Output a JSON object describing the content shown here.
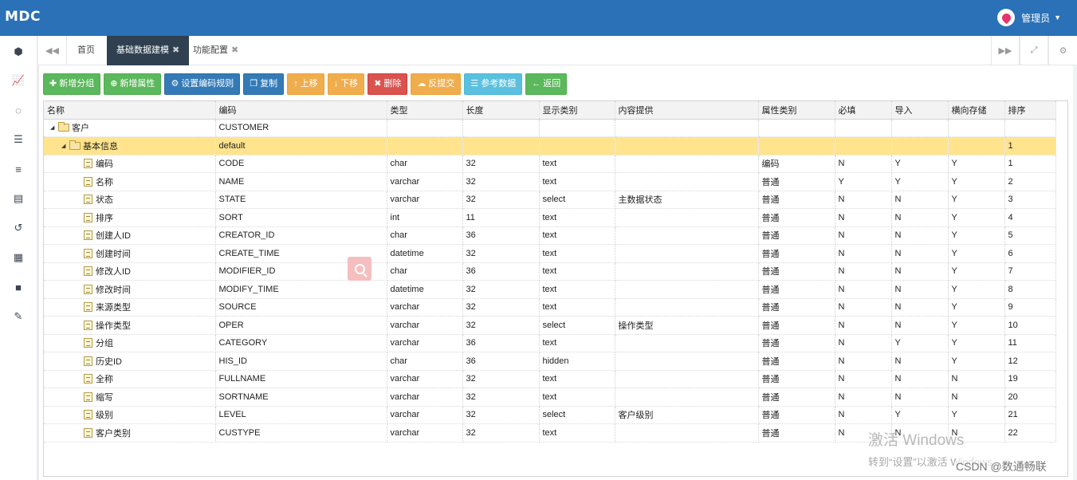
{
  "app": {
    "brand": "MDC",
    "user": "管理员"
  },
  "icons": {
    "avatar": "location-pin-icon",
    "caret": "caret-down-icon"
  },
  "colors": {
    "header": "#2a71b8",
    "active_tab": "#2f4050",
    "selected_row": "#ffe48d"
  },
  "sidebar": {
    "items": [
      {
        "name": "sidebar-item-home",
        "icon": "⬢"
      },
      {
        "name": "sidebar-item-chart",
        "icon": "📈"
      },
      {
        "name": "sidebar-item-loading",
        "icon": "◌"
      },
      {
        "name": "sidebar-item-database",
        "icon": "☰"
      },
      {
        "name": "sidebar-item-list",
        "icon": "≡"
      },
      {
        "name": "sidebar-item-tasks",
        "icon": "▤"
      },
      {
        "name": "sidebar-item-history",
        "icon": "↺"
      },
      {
        "name": "sidebar-item-film",
        "icon": "▦"
      },
      {
        "name": "sidebar-item-archive",
        "icon": "■"
      },
      {
        "name": "sidebar-item-settings",
        "icon": "✎"
      }
    ]
  },
  "tabs": [
    {
      "label": "首页",
      "closable": false,
      "active": false
    },
    {
      "label": "基础数据建模",
      "closable": true,
      "active": true
    },
    {
      "label": "功能配置",
      "closable": true,
      "active": false
    }
  ],
  "toolbar": {
    "add_group": "新增分组",
    "add_attr": "新增属性",
    "set_code_rule": "设置编码规则",
    "copy": "复制",
    "move_up": "上移",
    "move_down": "下移",
    "delete": "删除",
    "unsubmit": "反提交",
    "ref_data": "参考数据",
    "back": "返回"
  },
  "grid": {
    "columns": [
      "名称",
      "编码",
      "类型",
      "长度",
      "显示类别",
      "内容提供",
      "属性类别",
      "必填",
      "导入",
      "横向存储",
      "排序"
    ],
    "root": {
      "name": "客户",
      "code": "CUSTOMER"
    },
    "group": {
      "name": "基本信息",
      "code": "default",
      "sort": "1"
    },
    "rows": [
      [
        "编码",
        "CODE",
        "char",
        "32",
        "text",
        "",
        "编码",
        "N",
        "Y",
        "Y",
        "1"
      ],
      [
        "名称",
        "NAME",
        "varchar",
        "32",
        "text",
        "",
        "普通",
        "Y",
        "Y",
        "Y",
        "2"
      ],
      [
        "状态",
        "STATE",
        "varchar",
        "32",
        "select",
        "主数据状态",
        "普通",
        "N",
        "N",
        "Y",
        "3"
      ],
      [
        "排序",
        "SORT",
        "int",
        "11",
        "text",
        "",
        "普通",
        "N",
        "N",
        "Y",
        "4"
      ],
      [
        "创建人ID",
        "CREATOR_ID",
        "char",
        "36",
        "text",
        "",
        "普通",
        "N",
        "N",
        "Y",
        "5"
      ],
      [
        "创建时间",
        "CREATE_TIME",
        "datetime",
        "32",
        "text",
        "",
        "普通",
        "N",
        "N",
        "Y",
        "6"
      ],
      [
        "修改人ID",
        "MODIFIER_ID",
        "char",
        "36",
        "text",
        "",
        "普通",
        "N",
        "N",
        "Y",
        "7"
      ],
      [
        "修改时间",
        "MODIFY_TIME",
        "datetime",
        "32",
        "text",
        "",
        "普通",
        "N",
        "N",
        "Y",
        "8"
      ],
      [
        "来源类型",
        "SOURCE",
        "varchar",
        "32",
        "text",
        "",
        "普通",
        "N",
        "N",
        "Y",
        "9"
      ],
      [
        "操作类型",
        "OPER",
        "varchar",
        "32",
        "select",
        "操作类型",
        "普通",
        "N",
        "N",
        "Y",
        "10"
      ],
      [
        "分组",
        "CATEGORY",
        "varchar",
        "36",
        "text",
        "",
        "普通",
        "N",
        "Y",
        "Y",
        "11"
      ],
      [
        "历史ID",
        "HIS_ID",
        "char",
        "36",
        "hidden",
        "",
        "普通",
        "N",
        "N",
        "Y",
        "12"
      ],
      [
        "全称",
        "FULLNAME",
        "varchar",
        "32",
        "text",
        "",
        "普通",
        "N",
        "N",
        "N",
        "19"
      ],
      [
        "缩写",
        "SORTNAME",
        "varchar",
        "32",
        "text",
        "",
        "普通",
        "N",
        "N",
        "N",
        "20"
      ],
      [
        "级别",
        "LEVEL",
        "varchar",
        "32",
        "select",
        "客户级别",
        "普通",
        "N",
        "Y",
        "Y",
        "21"
      ],
      [
        "客户类别",
        "CUSTYPE",
        "varchar",
        "32",
        "text",
        "",
        "普通",
        "N",
        "N",
        "N",
        "22"
      ]
    ]
  },
  "overlay": {
    "watermark_title": "激活 Windows",
    "watermark_sub": "转到“设置”以激活 Windows。",
    "credit": "CSDN @数通畅联"
  }
}
